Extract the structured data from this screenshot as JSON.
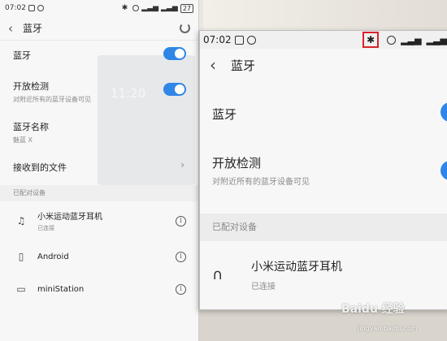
{
  "left": {
    "status": {
      "time": "07:02",
      "battery": "27"
    },
    "header": {
      "title": "蓝牙"
    },
    "ghost_time": "11:20",
    "settings": [
      {
        "title": "蓝牙",
        "subtitle": ""
      },
      {
        "title": "开放检测",
        "subtitle": "对附近所有的蓝牙设备可见"
      },
      {
        "title": "蓝牙名称",
        "subtitle": "魅蓝 X"
      },
      {
        "title": "接收到的文件",
        "subtitle": ""
      }
    ],
    "paired_section": "已配对设备",
    "devices": [
      {
        "name": "小米运动蓝牙耳机",
        "status": "已连接",
        "icon": "headphones-icon"
      },
      {
        "name": "Android",
        "status": "",
        "icon": "phone-icon"
      },
      {
        "name": "miniStation",
        "status": "",
        "icon": "laptop-icon"
      }
    ]
  },
  "right": {
    "status": {
      "time": "07:02"
    },
    "header": {
      "title": "蓝牙"
    },
    "settings": [
      {
        "title": "蓝牙",
        "subtitle": ""
      },
      {
        "title": "开放检测",
        "subtitle": "对附近所有的蓝牙设备可见"
      }
    ],
    "paired_section": "已配对设备",
    "devices": [
      {
        "name": "小米运动蓝牙耳机",
        "status": "已连接",
        "icon": "headphones-icon"
      }
    ]
  },
  "colors": {
    "toggle_on": "#2f86e6",
    "highlight": "#d9232a"
  },
  "watermark": {
    "main": "Baidu 经验",
    "sub": "jingyan.baidu.com"
  }
}
